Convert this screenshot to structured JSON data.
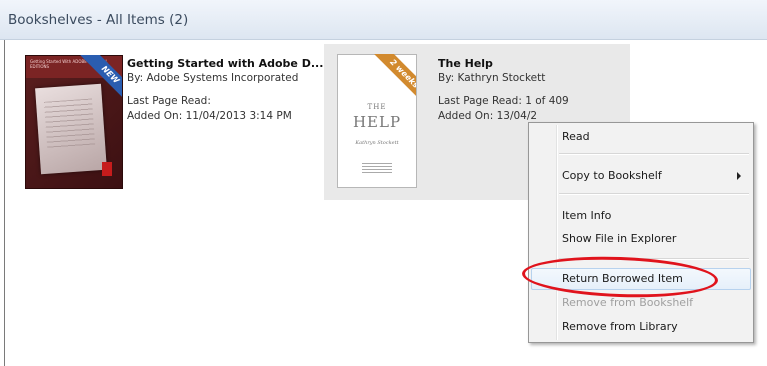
{
  "header": {
    "title": "Bookshelves - All Items (2)"
  },
  "books": [
    {
      "title": "Getting Started with Adobe D...",
      "author": "By: Adobe Systems Incorporated",
      "last_page": "Last Page Read:",
      "added_on": "Added On: 11/04/2013 3:14 PM",
      "badge": "NEW",
      "cover_text": "Getting Started With ADOBE® DIGITAL EDITIONS"
    },
    {
      "title": "The Help",
      "author": "By: Kathryn Stockett",
      "last_page": "Last Page Read: 1 of 409",
      "added_on": "Added On: 13/04/2",
      "badge": "2 weeks",
      "cover": {
        "the": "THE",
        "help": "HELP",
        "author": "Kathryn Stockett"
      }
    }
  ],
  "context_menu": {
    "items": [
      {
        "label": "Read",
        "enabled": true
      },
      {
        "label": "Copy to Bookshelf",
        "enabled": true,
        "submenu": true
      },
      {
        "label": "Item Info",
        "enabled": true
      },
      {
        "label": "Show File in Explorer",
        "enabled": true
      },
      {
        "label": "Return Borrowed Item",
        "enabled": true,
        "highlighted": true
      },
      {
        "label": "Remove from Bookshelf",
        "enabled": false
      },
      {
        "label": "Remove from Library",
        "enabled": true
      }
    ]
  },
  "colors": {
    "annotation": "#e0131c",
    "new_badge": "#2a5db0",
    "loan_badge": "#d28a2e"
  }
}
